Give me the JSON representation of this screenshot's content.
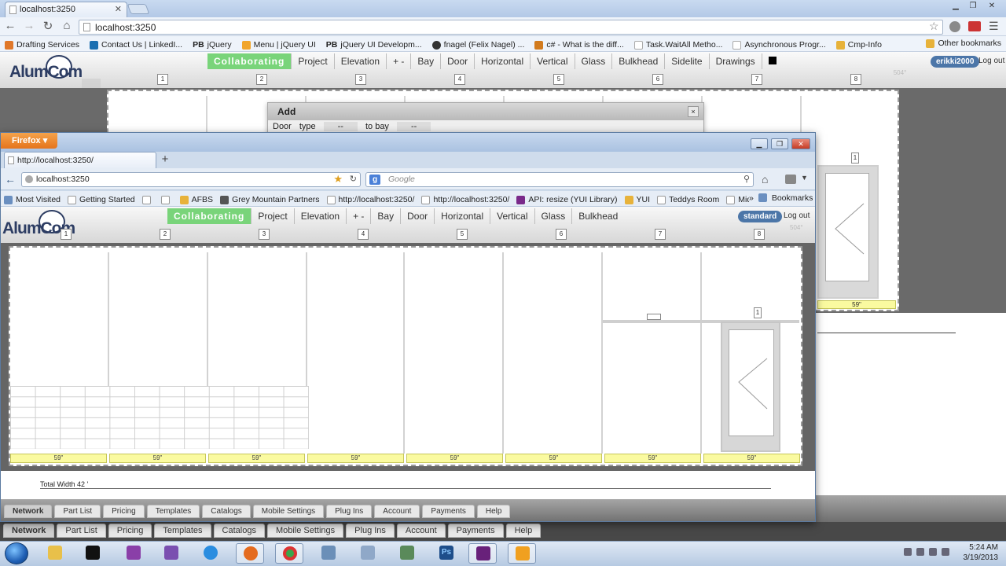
{
  "chrome": {
    "tab_title": "localhost:3250",
    "url": "localhost:3250",
    "bookmarks": [
      {
        "label": "Drafting Services",
        "color": "#e0782a"
      },
      {
        "label": "Contact Us | LinkedI...",
        "color": "#1b6fb1"
      },
      {
        "label": "jQuery",
        "prefix": "PB"
      },
      {
        "label": "Menu | jQuery UI",
        "color": "#f1a52b"
      },
      {
        "label": "jQuery UI Developm...",
        "prefix": "PB"
      },
      {
        "label": "fnagel (Felix Nagel) ...",
        "color": "#333333"
      },
      {
        "label": "c# - What is the diff...",
        "color": "#d27b1e"
      },
      {
        "label": "Task.WaitAll Metho...",
        "color": "#cccccc"
      },
      {
        "label": "Asynchronous Progr...",
        "color": "#cccccc"
      },
      {
        "label": "Cmp-Info",
        "color": "#e7b23a"
      }
    ],
    "other_bookmarks": "Other bookmarks"
  },
  "app_bg": {
    "nav": [
      "Collaborating",
      "Project",
      "Elevation",
      "+  -",
      "Bay",
      "Door",
      "Horizontal",
      "Vertical",
      "Glass",
      "Bulkhead",
      "Sidelite",
      "Drawings"
    ],
    "user": "erikki2000",
    "logout": "Log out",
    "ruler": [
      "1",
      "2",
      "3",
      "4",
      "5",
      "6",
      "7",
      "8"
    ],
    "angle_marker": "504°",
    "dialog": {
      "title": "Add",
      "close": "×",
      "row_label_1": "Door",
      "row_label_2": "type",
      "row_select_1": "--",
      "row_label_3": "to bay",
      "row_select_2": "--"
    },
    "right_dim": "59\"",
    "right_ruler_mark": "1",
    "bottom_tabs": [
      "Network",
      "Part List",
      "Pricing",
      "Templates",
      "Catalogs",
      "Mobile Settings",
      "Plug Ins",
      "Account",
      "Payments",
      "Help"
    ]
  },
  "firefox": {
    "menu_button": "Firefox",
    "tab_title": "http://localhost:3250/",
    "new_tab": "+",
    "url": "localhost:3250",
    "search_placeholder": "Google",
    "bookmarks": [
      {
        "label": "Most Visited"
      },
      {
        "label": "Getting Started"
      },
      {
        "label": ""
      },
      {
        "label": ""
      },
      {
        "label": "AFBS"
      },
      {
        "label": "Grey Mountain Partners"
      },
      {
        "label": "http://localhost:3250/"
      },
      {
        "label": "http://localhost:3250/"
      },
      {
        "label": "API: resize (YUI Library)"
      },
      {
        "label": "YUI"
      },
      {
        "label": "Teddys Room"
      },
      {
        "label": "Midland Glass"
      }
    ],
    "bookmarks_menu": "Bookmarks",
    "chevron": "»"
  },
  "app_fg": {
    "logo": "AlumCom",
    "nav": [
      "Collaborating",
      "Project",
      "Elevation",
      "+  -",
      "Bay",
      "Door",
      "Horizontal",
      "Vertical",
      "Glass",
      "Bulkhead"
    ],
    "user": "standard",
    "logout": "Log out",
    "ruler": [
      "1",
      "2",
      "3",
      "4",
      "5",
      "6",
      "7",
      "8"
    ],
    "angle_marker": "504°",
    "door_mark": "1",
    "dims": [
      "59\"",
      "59\"",
      "59\"",
      "59\"",
      "59\"",
      "59\"",
      "59\"",
      "59\""
    ],
    "total_width": "Total Width 42 '",
    "bottom_tabs": [
      "Network",
      "Part List",
      "Pricing",
      "Templates",
      "Catalogs",
      "Mobile Settings",
      "Plug Ins",
      "Account",
      "Payments",
      "Help"
    ]
  },
  "taskbar": {
    "time": "5:24 AM",
    "date": "3/19/2013",
    "apps": [
      {
        "name": "explorer-icon",
        "color": "#e8c04a"
      },
      {
        "name": "cmd-icon",
        "color": "#111111"
      },
      {
        "name": "media-icon",
        "color": "#8a3fa8"
      },
      {
        "name": "tool-icon",
        "color": "#7a4fb0"
      },
      {
        "name": "ie-icon",
        "color": "#2a8de0"
      },
      {
        "name": "firefox-icon",
        "color": "#e46b1f"
      },
      {
        "name": "chrome-icon",
        "color": "#3aa64c"
      },
      {
        "name": "network-icon",
        "color": "#6b8fb8"
      },
      {
        "name": "package-icon",
        "color": "#8fa8c8"
      },
      {
        "name": "server-icon",
        "color": "#5a8a5a"
      },
      {
        "name": "photoshop-icon",
        "color": "#1e4e8a"
      },
      {
        "name": "visualstudio-icon",
        "color": "#68217a"
      },
      {
        "name": "outlook-icon",
        "color": "#f0a020"
      }
    ]
  },
  "colors": {
    "accent_active_nav": "#79d47a",
    "dim_bar": "#fafaa0",
    "user_pill": "#4c76a8"
  }
}
